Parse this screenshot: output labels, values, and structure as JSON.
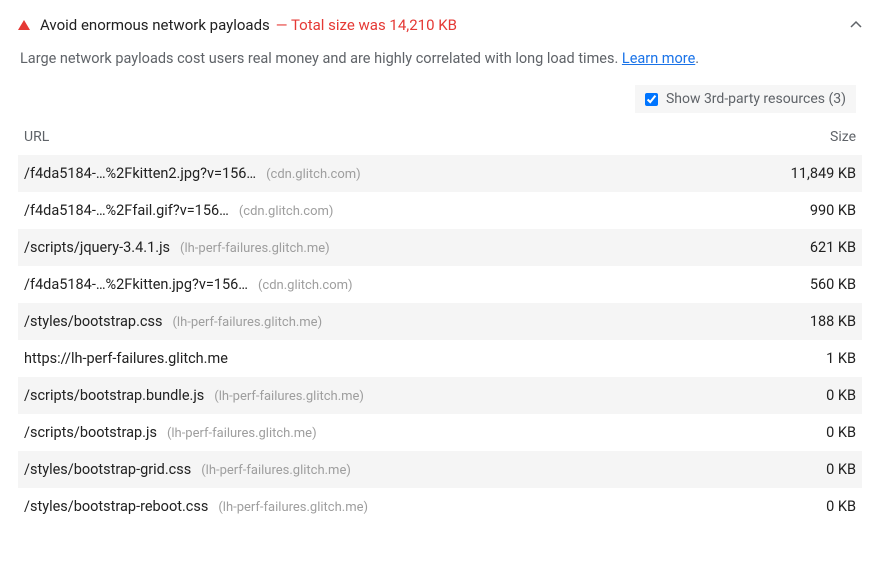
{
  "colors": {
    "warning": "#e53935",
    "link": "#1a73e8"
  },
  "audit": {
    "title": "Avoid enormous network payloads",
    "summary_prefix": " — ",
    "summary": "Total size was 14,210 KB",
    "description": "Large network payloads cost users real money and are highly correlated with long load times. ",
    "learn_more_label": "Learn more",
    "description_suffix": "."
  },
  "toggle": {
    "label": "Show 3rd-party resources (3)",
    "checked": true
  },
  "table": {
    "headers": {
      "url": "URL",
      "size": "Size"
    },
    "rows": [
      {
        "path": "/f4da5184-…%2Fkitten2.jpg?v=156…",
        "host": "(cdn.glitch.com)",
        "size": "11,849 KB"
      },
      {
        "path": "/f4da5184-…%2Ffail.gif?v=156…",
        "host": "(cdn.glitch.com)",
        "size": "990 KB"
      },
      {
        "path": "/scripts/jquery-3.4.1.js",
        "host": "(lh-perf-failures.glitch.me)",
        "size": "621 KB"
      },
      {
        "path": "/f4da5184-…%2Fkitten.jpg?v=156…",
        "host": "(cdn.glitch.com)",
        "size": "560 KB"
      },
      {
        "path": "/styles/bootstrap.css",
        "host": "(lh-perf-failures.glitch.me)",
        "size": "188 KB"
      },
      {
        "path": "https://lh-perf-failures.glitch.me",
        "host": "",
        "size": "1 KB"
      },
      {
        "path": "/scripts/bootstrap.bundle.js",
        "host": "(lh-perf-failures.glitch.me)",
        "size": "0 KB"
      },
      {
        "path": "/scripts/bootstrap.js",
        "host": "(lh-perf-failures.glitch.me)",
        "size": "0 KB"
      },
      {
        "path": "/styles/bootstrap-grid.css",
        "host": "(lh-perf-failures.glitch.me)",
        "size": "0 KB"
      },
      {
        "path": "/styles/bootstrap-reboot.css",
        "host": "(lh-perf-failures.glitch.me)",
        "size": "0 KB"
      }
    ]
  }
}
